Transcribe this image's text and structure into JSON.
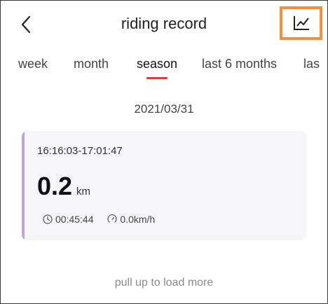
{
  "header": {
    "title": "riding record",
    "back_icon": "chevron-left-icon",
    "chart_icon": "line-chart-icon",
    "highlight_color": "#f2913d"
  },
  "tabs": [
    {
      "label": "week",
      "active": false
    },
    {
      "label": "month",
      "active": false
    },
    {
      "label": "season",
      "active": true
    },
    {
      "label": "last 6 months",
      "active": false
    },
    {
      "label": "las",
      "active": false
    }
  ],
  "tab_indicator_color": "#d6403a",
  "date": "2021/03/31",
  "records": [
    {
      "time_range": "16:16:03-17:01:47",
      "distance": "0.2",
      "distance_unit": "km",
      "duration_icon": "clock-icon",
      "duration": "00:45:44",
      "speed_icon": "speedometer-icon",
      "speed": "0.0km/h",
      "accent_color": "#b8a5e3"
    }
  ],
  "footer": {
    "load_more": "pull up to load more"
  }
}
